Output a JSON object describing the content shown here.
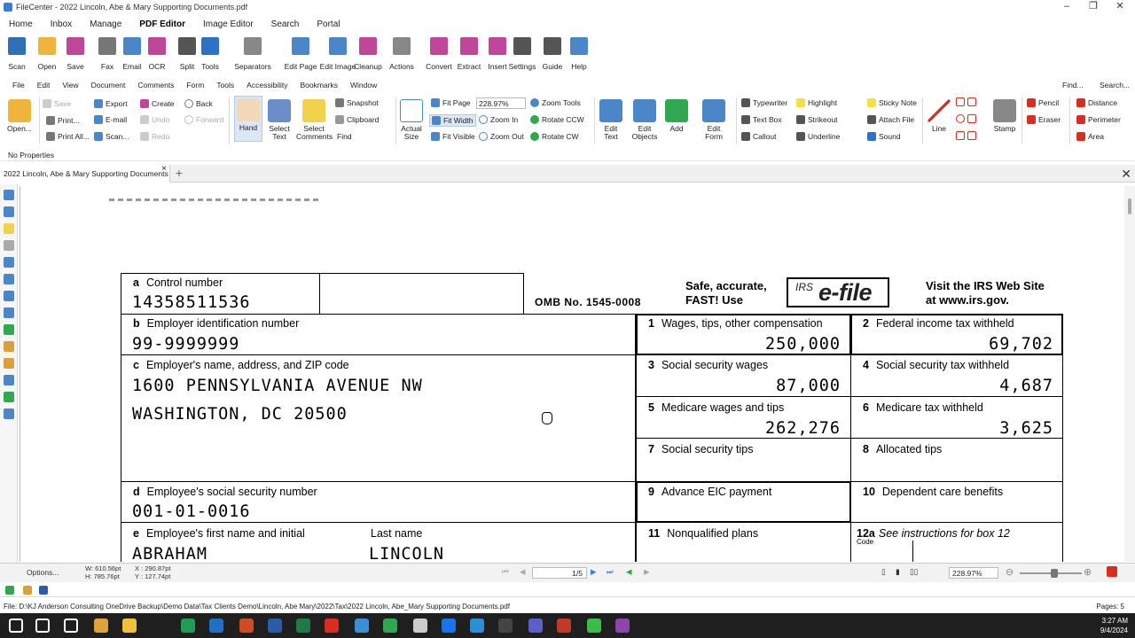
{
  "window": {
    "title": "FileCenter - 2022 Lincoln, Abe & Mary Supporting Documents.pdf",
    "minimize": "–",
    "restore": "❐",
    "close": "✕"
  },
  "ribbon_tabs": [
    "Home",
    "Inbox",
    "Manage",
    "PDF Editor",
    "Image Editor",
    "Search",
    "Portal"
  ],
  "ribbon_active": "PDF Editor",
  "toolbar1": [
    {
      "label": "Scan",
      "icon": "scanner-icon",
      "color": "#2f6fb5"
    },
    {
      "label": "Open",
      "icon": "folder-open-icon",
      "color": "#f0b43c"
    },
    {
      "label": "Save",
      "icon": "save-icon",
      "color": "#c0469a"
    },
    {
      "label": "Fax",
      "icon": "fax-icon",
      "color": "#777777"
    },
    {
      "label": "Email",
      "icon": "email-icon",
      "color": "#4a86c8"
    },
    {
      "label": "OCR",
      "icon": "ocr-icon",
      "color": "#c0469a"
    },
    {
      "label": "Split",
      "icon": "split-icon",
      "color": "#555555"
    },
    {
      "label": "Tools",
      "icon": "tools-icon",
      "color": "#2a73c6"
    },
    {
      "label": "Separators",
      "icon": "separators-icon",
      "color": "#888888"
    },
    {
      "label": "Edit Page",
      "icon": "edit-page-icon",
      "color": "#4a86c8"
    },
    {
      "label": "Edit Image",
      "icon": "edit-image-icon",
      "color": "#4a86c8"
    },
    {
      "label": "Cleanup",
      "icon": "cleanup-icon",
      "color": "#c0469a"
    },
    {
      "label": "Actions",
      "icon": "actions-icon",
      "color": "#888888"
    },
    {
      "label": "Convert",
      "icon": "convert-icon",
      "color": "#c0469a"
    },
    {
      "label": "Extract",
      "icon": "extract-icon",
      "color": "#c0469a"
    },
    {
      "label": "Insert",
      "icon": "insert-icon",
      "color": "#c0469a"
    },
    {
      "label": "Settings",
      "icon": "settings-icon",
      "color": "#555555"
    },
    {
      "label": "Guide",
      "icon": "guide-icon",
      "color": "#555555"
    },
    {
      "label": "Help",
      "icon": "help-icon",
      "color": "#4a86c8"
    }
  ],
  "menubar2": [
    "File",
    "Edit",
    "View",
    "Document",
    "Comments",
    "Form",
    "Tools",
    "Accessibility",
    "Bookmarks",
    "Window"
  ],
  "menubar2_right": {
    "find": "Find...",
    "search": "Search..."
  },
  "toolbar2": {
    "open": "Open...",
    "save": "Save",
    "print": "Print...",
    "print_all": "Print All...",
    "export": "Export",
    "email": "E-mail",
    "scan": "Scan...",
    "create": "Create",
    "undo": "Undo",
    "redo": "Redo",
    "back": "Back",
    "forward": "Forward",
    "hand": "Hand",
    "select_text": "Select Text",
    "select_comments": "Select Comments",
    "snapshot": "Snapshot",
    "clipboard": "Clipboard",
    "find": "Find",
    "actual_size": "Actual Size",
    "fit_page": "Fit Page",
    "fit_width": "Fit Width",
    "fit_visible": "Fit Visible",
    "zoom_value": "228.97%",
    "zoom_tools": "Zoom Tools",
    "zoom_in": "Zoom In",
    "zoom_out": "Zoom Out",
    "rotate_ccw": "Rotate CCW",
    "rotate_cw": "Rotate CW",
    "edit_text": "Edit Text",
    "edit_objects": "Edit Objects",
    "add": "Add",
    "edit_form": "Edit Form",
    "typewriter": "Typewriter",
    "text_box": "Text Box",
    "callout": "Callout",
    "highlight": "Highlight",
    "strikeout": "Strikeout",
    "underline": "Underline",
    "sticky_note": "Sticky Note",
    "attach_file": "Attach File",
    "sound": "Sound",
    "line": "Line",
    "stamp": "Stamp",
    "pencil": "Pencil",
    "eraser": "Eraser",
    "distance": "Distance",
    "perimeter": "Perimeter",
    "area": "Area"
  },
  "properties": "No Properties",
  "doc_tab": "2022 Lincoln, Abe & Mary Supporting Documents",
  "w2": {
    "a_label": "a",
    "a_title": "Control number",
    "a_value": "14358511536",
    "omb": "OMB No. 1545-0008",
    "safe": "Safe, accurate,",
    "fast": "FAST! Use",
    "irs": "IRS",
    "efile": "e-file",
    "visit1": "Visit the IRS Web Site",
    "visit2": "at www.irs.gov.",
    "b_label": "b",
    "b_title": "Employer identification number",
    "b_value": "99-9999999",
    "c_label": "c",
    "c_title": "Employer's name, address, and ZIP code",
    "c_line1": "1600 PENNSYLVANIA AVENUE NW",
    "c_line2": "WASHINGTON, DC  20500",
    "d_label": "d",
    "d_title": "Employee's social security number",
    "d_value": "001-01-0016",
    "e_label": "e",
    "e_title": "Employee's first name and initial",
    "e_last_title": "Last name",
    "e_first": "ABRAHAM",
    "e_last": "LINCOLN",
    "b1_num": "1",
    "b1_title": "Wages, tips, other compensation",
    "b1_value": "250,000",
    "b2_num": "2",
    "b2_title": "Federal income tax withheld",
    "b2_value": "69,702",
    "b3_num": "3",
    "b3_title": "Social security wages",
    "b3_value": "87,000",
    "b4_num": "4",
    "b4_title": "Social security tax withheld",
    "b4_value": "4,687",
    "b5_num": "5",
    "b5_title": "Medicare wages and tips",
    "b5_value": "262,276",
    "b6_num": "6",
    "b6_title": "Medicare tax withheld",
    "b6_value": "3,625",
    "b7_num": "7",
    "b7_title": "Social security tips",
    "b8_num": "8",
    "b8_title": "Allocated tips",
    "b9_num": "9",
    "b9_title": "Advance EIC payment",
    "b10_num": "10",
    "b10_title": "Dependent care benefits",
    "b11_num": "11",
    "b11_title": "Nonqualified plans",
    "b12_num": "12a",
    "b12_title": "See instructions for box 12",
    "b12_code": "Code"
  },
  "bottom": {
    "options": "Options...",
    "dims": "W: 610.56pt\nH: 785.76pt",
    "coords": "X : 290.87pt\nY : 127.74pt",
    "w": "W: 610.56pt",
    "h": "H: 785.76pt",
    "x": "X : 290.87pt",
    "y": "Y : 127.74pt",
    "page": "1/5",
    "zoom": "228.97%"
  },
  "status": {
    "file": "File: D:\\KJ Anderson Consulting OneDrive Backup\\Demo Data\\Tax Clients Demo\\Lincoln, Abe  Mary\\2022\\Tax\\2022 Lincoln, Abe_Mary Supporting Documents.pdf",
    "pages": "Pages: 5"
  },
  "clock": {
    "time": "3:27 AM",
    "date": "9/4/2024"
  },
  "taskbar_icons": [
    {
      "name": "start-icon",
      "color": "#ffffff"
    },
    {
      "name": "search-icon",
      "color": "#ffffff"
    },
    {
      "name": "task-view-icon",
      "color": "#ffffff"
    },
    {
      "name": "chrome-icon",
      "color": "#e0a33a"
    },
    {
      "name": "file-explorer-icon",
      "color": "#f0c23c"
    },
    {
      "name": "app-green-icon",
      "color": "#1f9d55"
    },
    {
      "name": "outlook-icon",
      "color": "#1f6fc4"
    },
    {
      "name": "powerpoint-icon",
      "color": "#d04a23"
    },
    {
      "name": "word-icon",
      "color": "#2b5cab"
    },
    {
      "name": "excel-icon",
      "color": "#1e7b45"
    },
    {
      "name": "acrobat-icon",
      "color": "#d92d20"
    },
    {
      "name": "filecenter-icon",
      "color": "#3a8fd6"
    },
    {
      "name": "app-green2-icon",
      "color": "#2fa84f"
    },
    {
      "name": "app-gray-icon",
      "color": "#cccccc"
    },
    {
      "name": "app-blue-icon",
      "color": "#1a73e8"
    },
    {
      "name": "edge-icon",
      "color": "#2c8fd6"
    },
    {
      "name": "terminal-icon",
      "color": "#444444"
    },
    {
      "name": "teams-icon",
      "color": "#5b5fc7"
    },
    {
      "name": "app-red-icon",
      "color": "#c0392b"
    },
    {
      "name": "camtasia-icon",
      "color": "#3dbb4a"
    },
    {
      "name": "app-purple-icon",
      "color": "#8e44ad"
    }
  ]
}
